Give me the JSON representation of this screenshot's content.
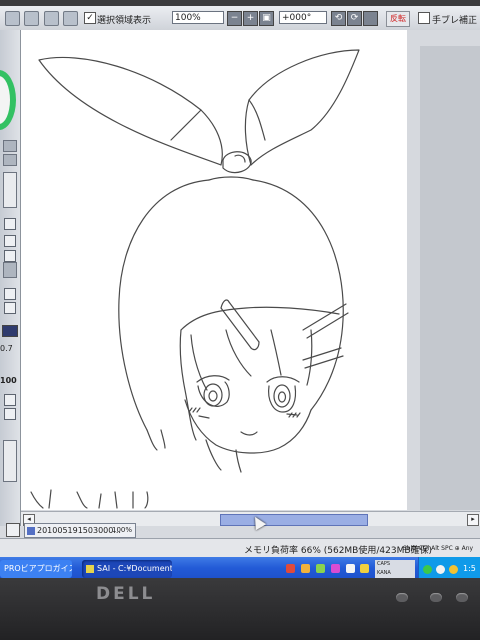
{
  "toolbar": {
    "checkbox_mark": "✓",
    "show_selection_label": "選択領域表示",
    "zoom_value": "100%",
    "zoom_out_label": "−",
    "zoom_in_label": "+",
    "zoom_reset_label": "▣",
    "rotation_value": "+000°",
    "rotate_left_label": "⟲",
    "rotate_right_label": "⟳",
    "flip_label": "反転",
    "stabilizer_label": "手ブレ補正"
  },
  "left_panel": {
    "value_1": "0.7",
    "value_2": "100"
  },
  "document_tab": {
    "filename": "201005191503000...",
    "zoom": "100%"
  },
  "status": {
    "memory_text": "メモリ負荷率 66% (562MB使用/423MB確保)",
    "keys": "Shift Ctrl Alt SPC ⊕ Any"
  },
  "taskbar": {
    "item_1": "PROビアプロガイス...",
    "item_2": "SAI - C:¥Documents ...",
    "ime_line_1": "CAPS",
    "ime_line_2": "KANA",
    "clock": "1:5"
  },
  "monitor": {
    "brand": "DELL"
  },
  "colors": {
    "accent_green": "#33c163",
    "scroll_thumb": "#9aaee4",
    "taskbar_blue": "#225ad6",
    "systray_blue": "#0f9ae9",
    "flip_red": "#d02020"
  }
}
